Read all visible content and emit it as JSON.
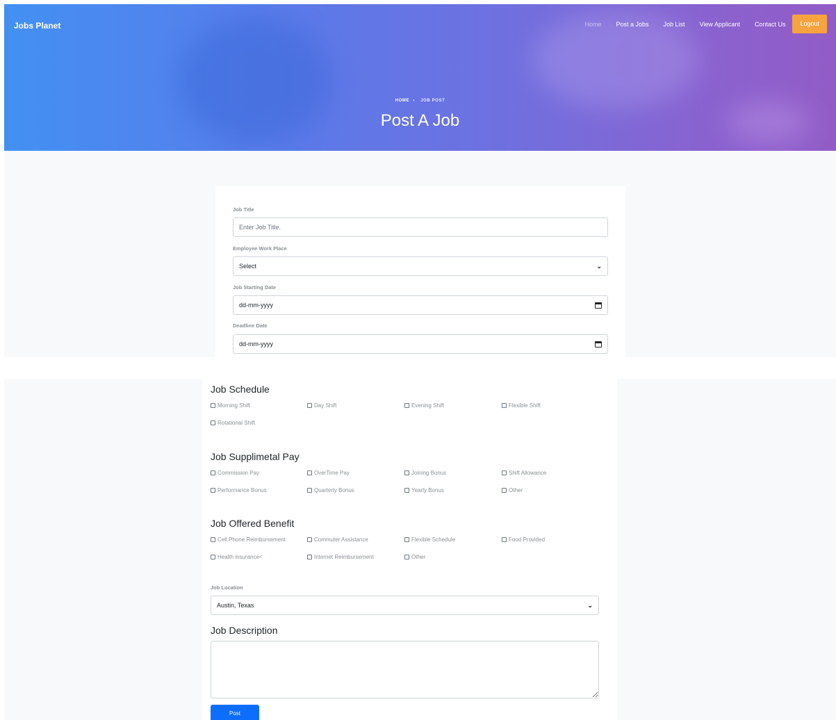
{
  "brand": "Jobs Planet",
  "nav": {
    "home": "Home",
    "post_jobs": "Post a Jobs",
    "job_list": "Job List",
    "view_applicant": "View Applicant",
    "contact": "Contact Us",
    "logout": "Logout"
  },
  "hero": {
    "crumb_home": "HOME",
    "crumb_sep": "›",
    "crumb_current": "JOB POST",
    "title": "Post A Job"
  },
  "form": {
    "job_title_label": "Job Title",
    "job_title_placeholder": "Enter Job Title.",
    "workplace_label": "Employee Work Place",
    "workplace_value": "Select",
    "start_date_label": "Job Starting Date",
    "start_date_value": "dd-mm-yyyy",
    "deadline_label": "Deadline Date",
    "deadline_value": "dd-mm-yyyy",
    "schedule_heading": "Job Schedule",
    "schedule_options": [
      "Morning Shift",
      "Day Shift",
      "Evening Shift",
      "Flexible Shift",
      "Rotational Shift"
    ],
    "pay_heading": "Job Supplimetal Pay",
    "pay_options": [
      "Commission Pay",
      "OverTime Pay",
      "Joining Bonus",
      "Shift Allowance",
      "Performance Bonus",
      "Quarterly Bonus",
      "Yearly Bonus",
      "Other"
    ],
    "benefit_heading": "Job Offered Benefit",
    "benefit_options": [
      "Cell Phone Reimbursement",
      "Commuter Assistance",
      "Flexible Schedule",
      "Food Provided",
      "Health insurance<",
      "Internet Reimbursement",
      "Other"
    ],
    "location_label": "Job Location",
    "location_value": "Austin, Texas",
    "description_heading": "Job Description",
    "submit_label": "Post"
  },
  "colors": {
    "hero_start": "#4390f3",
    "hero_end": "#925cc6",
    "logout_bg": "#f7a440",
    "primary": "#0d6efd"
  }
}
